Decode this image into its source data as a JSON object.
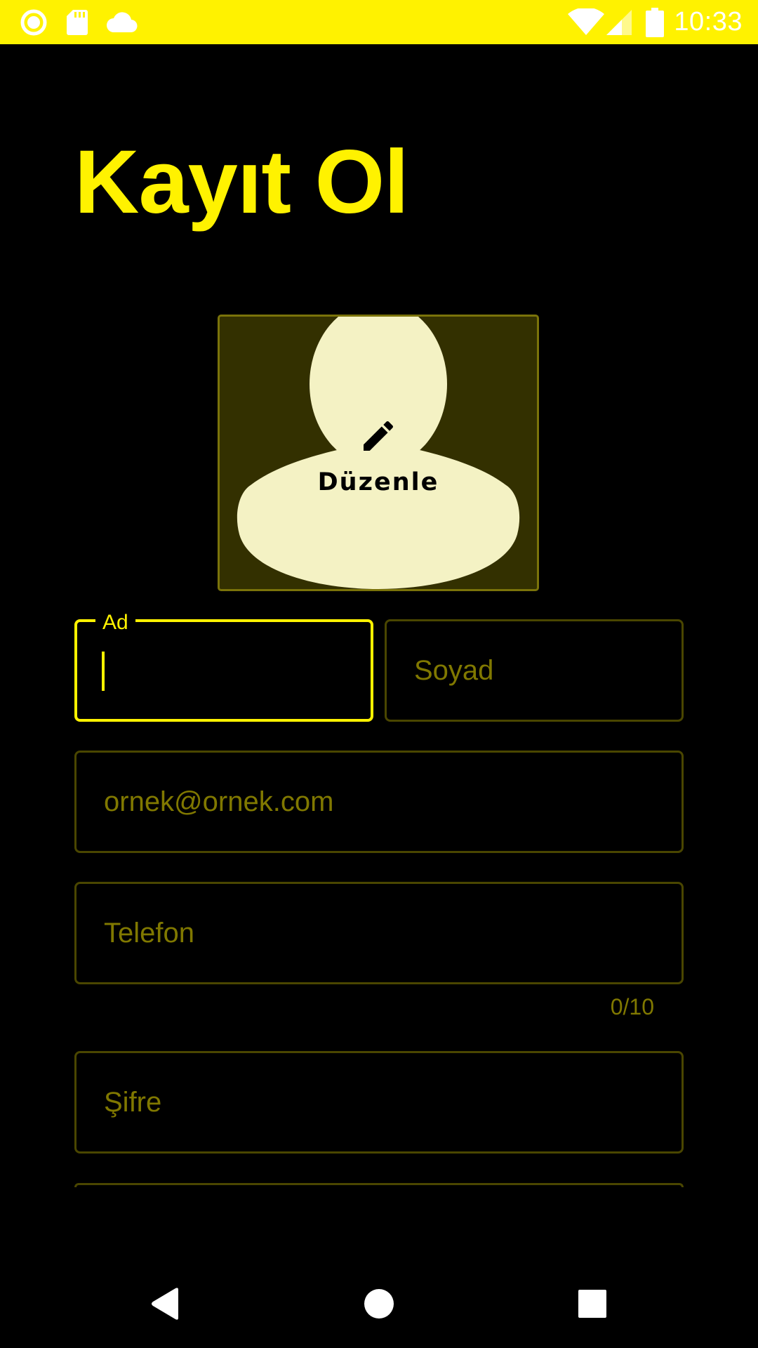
{
  "status_bar": {
    "time": "10:33",
    "left_icons": [
      "record-icon",
      "sd-card-icon",
      "cloud-icon"
    ],
    "right_icons": [
      "wifi-icon",
      "cell-signal-icon",
      "battery-icon"
    ]
  },
  "page": {
    "title": "Kayıt Ol"
  },
  "avatar": {
    "edit_label": "Düzenle",
    "edit_icon": "pencil-icon"
  },
  "form": {
    "first_name": {
      "label": "Ad",
      "value": ""
    },
    "last_name": {
      "placeholder": "Soyad"
    },
    "email": {
      "placeholder": "ornek@ornek.com"
    },
    "phone": {
      "placeholder": "Telefon",
      "counter": "0/10"
    },
    "password": {
      "placeholder": "Şifre"
    }
  },
  "nav_bar": {
    "buttons": [
      "back-icon",
      "home-icon",
      "recents-icon"
    ]
  },
  "colors": {
    "accent": "#FFF200",
    "background": "#000000",
    "field_border": "#4A4600",
    "placeholder": "#807800",
    "avatar_bg": "#333000",
    "avatar_figure": "#F4F2C4"
  }
}
